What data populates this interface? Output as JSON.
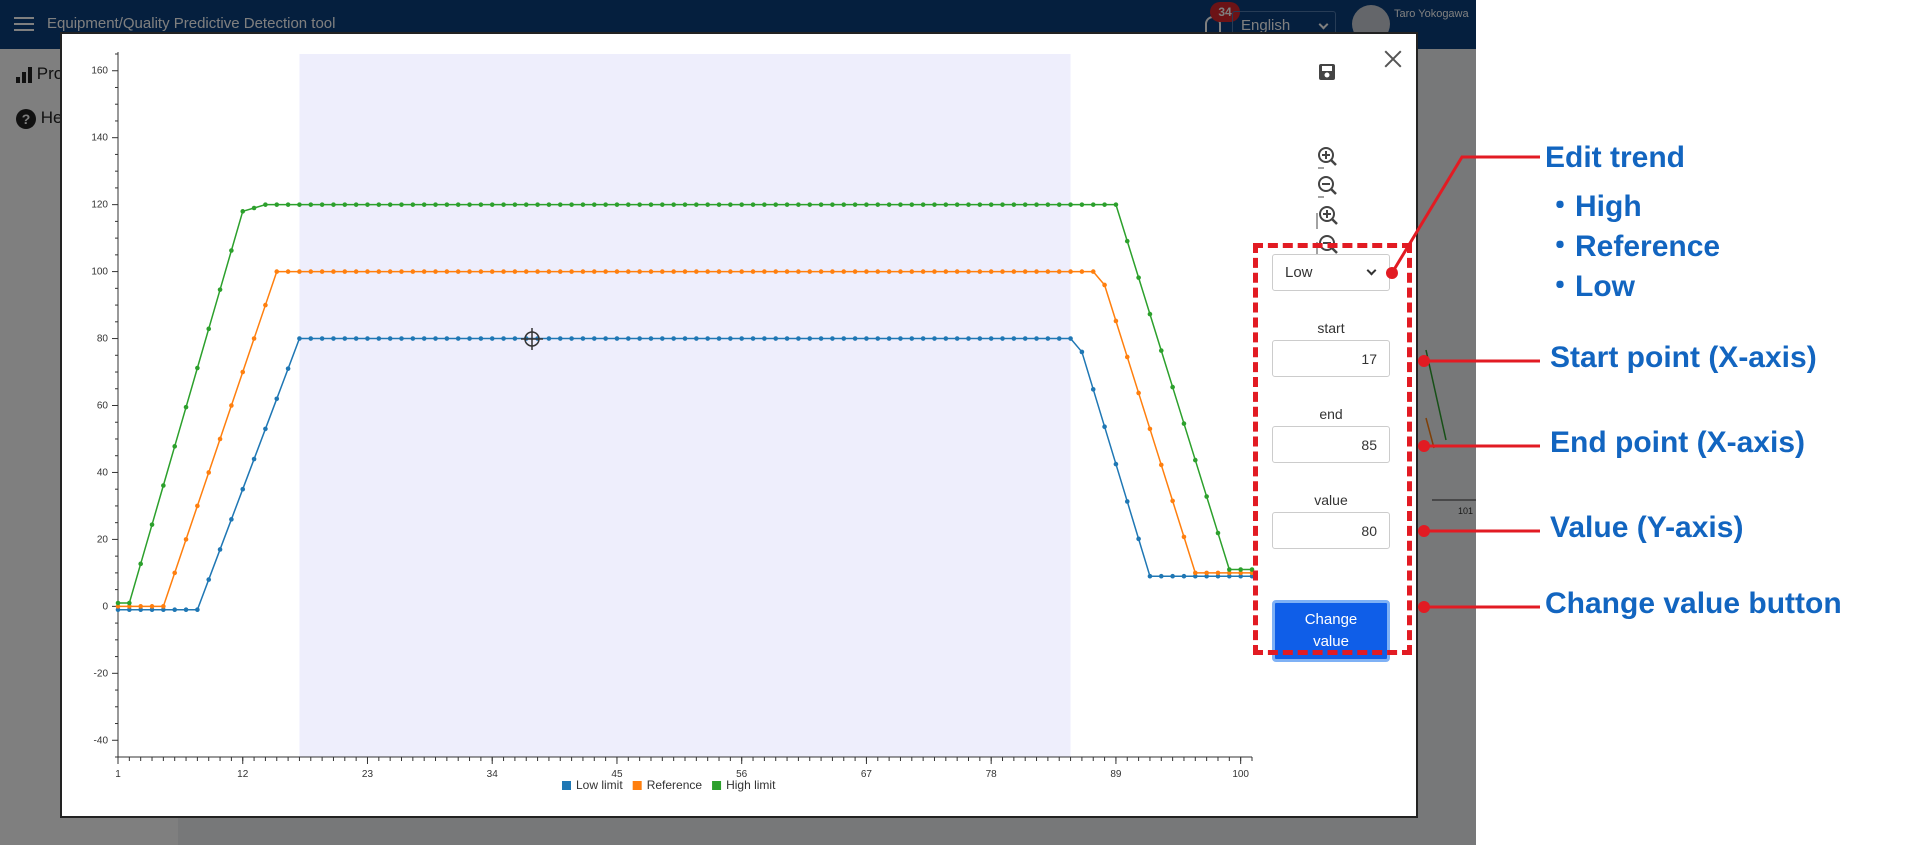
{
  "app": {
    "title": "Equipment/Quality Predictive Detection tool",
    "notification_count": "34",
    "language": "English",
    "user_name": "Taro Yokogawa",
    "sidebar": {
      "item1_label": "Pro",
      "item2_label": "He"
    }
  },
  "modal": {
    "toolbar": [
      "save-icon",
      "zoom-in-icon",
      "zoom-out-icon",
      "zoom-in-x-icon",
      "zoom-out-x-icon"
    ],
    "panel": {
      "trend_selected": "Low",
      "trend_options": [
        "High",
        "Reference",
        "Low"
      ],
      "start_label": "start",
      "start_value": "17",
      "end_label": "end",
      "end_value": "85",
      "value_label": "value",
      "value_value": "80",
      "change_button_line1": "Change",
      "change_button_line2": "value"
    }
  },
  "chart_data": {
    "type": "line",
    "x": [
      1,
      2,
      3,
      4,
      5,
      6,
      7,
      8,
      9,
      10,
      11,
      12,
      13,
      14,
      15,
      16,
      17,
      18,
      19,
      20,
      21,
      22,
      23,
      24,
      25,
      26,
      27,
      28,
      29,
      30,
      31,
      32,
      33,
      34,
      35,
      36,
      37,
      38,
      39,
      40,
      41,
      42,
      43,
      44,
      45,
      46,
      47,
      48,
      49,
      50,
      51,
      52,
      53,
      54,
      55,
      56,
      57,
      58,
      59,
      60,
      61,
      62,
      63,
      64,
      65,
      66,
      67,
      68,
      69,
      70,
      71,
      72,
      73,
      74,
      75,
      76,
      77,
      78,
      79,
      80,
      81,
      82,
      83,
      84,
      85,
      86,
      87,
      88,
      89,
      90,
      91,
      92,
      93,
      94,
      95,
      96,
      97,
      98,
      99,
      100,
      101
    ],
    "x_ticks": [
      1,
      12,
      23,
      34,
      45,
      56,
      67,
      78,
      89,
      100
    ],
    "y_ticks": [
      -40,
      -20,
      0,
      20,
      40,
      60,
      80,
      100,
      120,
      140,
      160
    ],
    "ylim": [
      -45,
      165
    ],
    "highlight_range": [
      17,
      85
    ],
    "legend_position": "bottom",
    "series": [
      {
        "name": "Low limit",
        "color": "#1f77b4",
        "segments": [
          [
            1,
            -1
          ],
          [
            8,
            -1
          ],
          [
            17,
            80
          ],
          [
            85,
            80
          ],
          [
            86,
            76
          ],
          [
            92,
            9
          ],
          [
            101,
            9
          ]
        ]
      },
      {
        "name": "Reference",
        "color": "#ff7f0e",
        "segments": [
          [
            1,
            0
          ],
          [
            5,
            0
          ],
          [
            15,
            100
          ],
          [
            87,
            100
          ],
          [
            88,
            96
          ],
          [
            96,
            10
          ],
          [
            101,
            10
          ]
        ]
      },
      {
        "name": "High limit",
        "color": "#2ca02c",
        "segments": [
          [
            1,
            1
          ],
          [
            2,
            1
          ],
          [
            12,
            118
          ],
          [
            13,
            119
          ],
          [
            14,
            120
          ],
          [
            89,
            120
          ],
          [
            99,
            11
          ],
          [
            101,
            11
          ]
        ]
      }
    ]
  },
  "annotations": {
    "edit_trend": "Edit trend",
    "option_high": "・High",
    "option_reference": "・Reference",
    "option_low": "・Low",
    "start_point": "Start point (X-axis)",
    "end_point": "End point (X-axis)",
    "value_axis": "Value (Y-axis)",
    "change_button": "Change value button",
    "color": "#1265c0",
    "accent": "#e21b23"
  }
}
